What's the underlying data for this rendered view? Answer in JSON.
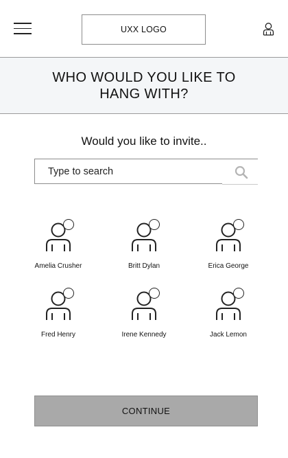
{
  "header": {
    "logo_text": "UXX LOGO",
    "menu_icon": "hamburger-menu-icon",
    "user_icon": "user-profile-icon"
  },
  "banner": {
    "title": "WHO WOULD YOU LIKE TO HANG WITH?"
  },
  "invite": {
    "subtitle": "Would you like to invite.."
  },
  "search": {
    "placeholder": "Type to search",
    "value": "",
    "icon": "search-icon"
  },
  "friends": [
    {
      "name": "Amelia Crusher",
      "selected": false
    },
    {
      "name": "Britt Dylan",
      "selected": false
    },
    {
      "name": "Erica George",
      "selected": false
    },
    {
      "name": "Fred Henry",
      "selected": false
    },
    {
      "name": "Irene Kennedy",
      "selected": false
    },
    {
      "name": "Jack Lemon",
      "selected": false
    }
  ],
  "continue_label": "CONTINUE",
  "colors": {
    "banner_bg": "#f4f6f8",
    "button_bg": "#a9a9a9",
    "border": "#8c8c8c"
  }
}
